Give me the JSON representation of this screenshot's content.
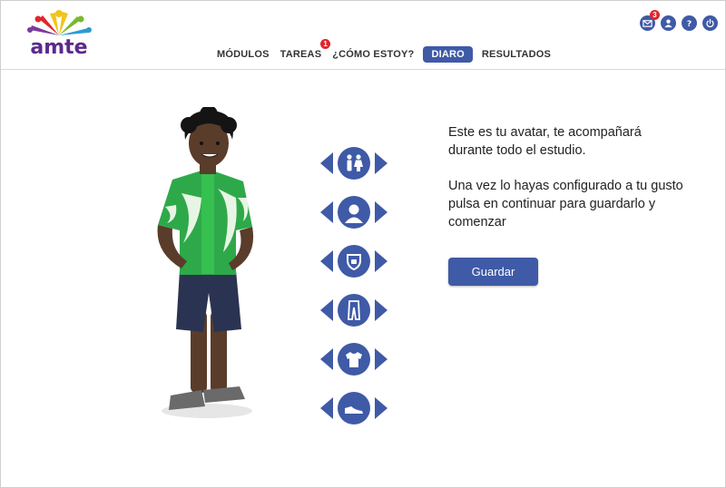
{
  "brand": {
    "logo_text": "amte"
  },
  "nav": {
    "items": [
      {
        "label": "MÓDULOS",
        "active": false,
        "badge": ""
      },
      {
        "label": "TAREAS",
        "active": false,
        "badge": "1"
      },
      {
        "label": "¿CÓMO ESTOY?",
        "active": false,
        "badge": ""
      },
      {
        "label": "DIARO",
        "active": true,
        "badge": ""
      },
      {
        "label": "RESULTADOS",
        "active": false,
        "badge": ""
      }
    ]
  },
  "top_icons": {
    "messages_badge": "3",
    "icons": [
      "mail-icon",
      "user-icon",
      "help-icon",
      "power-icon"
    ]
  },
  "colors": {
    "accent": "#3f5aa6",
    "badge": "#e0262b"
  },
  "avatar_options": {
    "categories": [
      "gender-icon",
      "face-icon",
      "body-icon",
      "pants-icon",
      "shirt-icon",
      "shoe-icon"
    ]
  },
  "info": {
    "paragraph1": "Este es tu avatar, te acompañará durante todo el estudio.",
    "paragraph2": "Una vez lo hayas configurado a tu gusto pulsa en continuar para guardarlo y comenzar"
  },
  "actions": {
    "save_label": "Guardar"
  }
}
